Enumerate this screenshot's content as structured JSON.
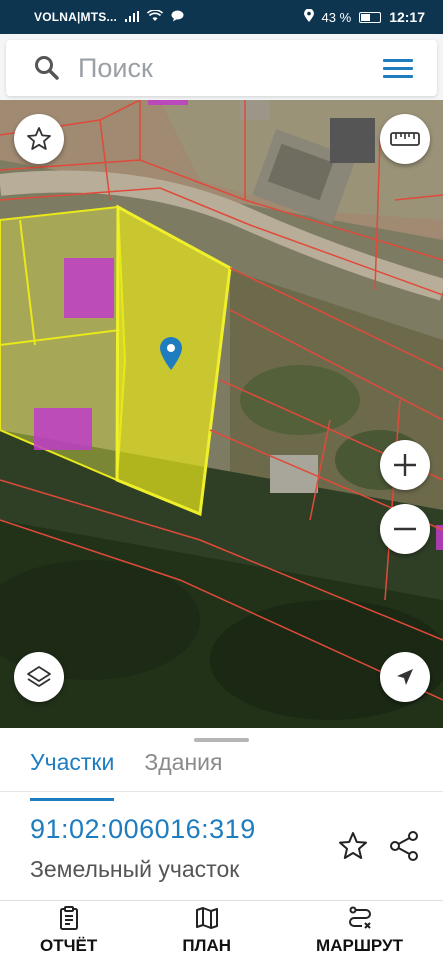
{
  "status_bar": {
    "carrier": "VOLNA|MTS...",
    "battery": "43 %",
    "time": "12:17"
  },
  "search": {
    "placeholder": "Поиск"
  },
  "sheet": {
    "tabs": [
      {
        "label": "Участки",
        "active": true
      },
      {
        "label": "Здания",
        "active": false
      }
    ],
    "parcel_id": "91:02:006016:319",
    "parcel_type": "Земельный участок"
  },
  "bottom_nav": {
    "report": "ОТЧЁТ",
    "plan": "ПЛАН",
    "route": "МАРШРУТ"
  },
  "colors": {
    "accent": "#1f7dbf",
    "parcel_fill": "#e8e81a",
    "building_fill": "#c03cc8",
    "boundary": "#e04a3a"
  }
}
